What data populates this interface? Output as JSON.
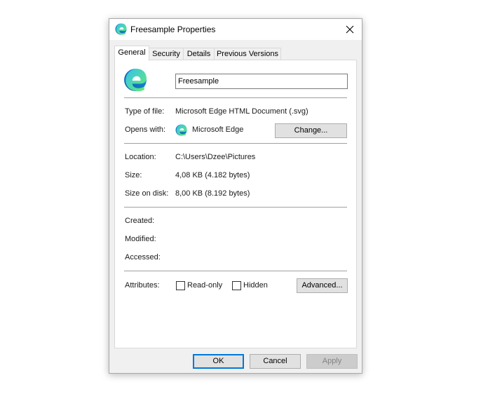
{
  "window": {
    "title": "Freesample Properties",
    "close_icon": "close-icon",
    "app_icon": "microsoft-edge-icon"
  },
  "tabs": [
    {
      "label": "General",
      "active": true
    },
    {
      "label": "Security",
      "active": false
    },
    {
      "label": "Details",
      "active": false
    },
    {
      "label": "Previous Versions",
      "active": false
    }
  ],
  "general": {
    "file_name": "Freesample",
    "type_of_file_label": "Type of file:",
    "type_of_file_value": "Microsoft Edge HTML Document (.svg)",
    "opens_with_label": "Opens with:",
    "opens_with_value": "Microsoft Edge",
    "change_button": "Change...",
    "location_label": "Location:",
    "location_value": "C:\\Users\\Dzee\\Pictures",
    "size_label": "Size:",
    "size_value": "4,08 KB (4.182 bytes)",
    "size_on_disk_label": "Size on disk:",
    "size_on_disk_value": "8,00 KB (8.192 bytes)",
    "created_label": "Created:",
    "modified_label": "Modified:",
    "accessed_label": "Accessed:",
    "attributes_label": "Attributes:",
    "readonly_label": "Read-only",
    "readonly_checked": false,
    "hidden_label": "Hidden",
    "hidden_checked": false,
    "advanced_button": "Advanced..."
  },
  "footer": {
    "ok": "OK",
    "cancel": "Cancel",
    "apply": "Apply"
  },
  "colors": {
    "dialog_bg": "#f0f0f0",
    "panel_bg": "#ffffff",
    "button_bg": "#e1e1e1",
    "focus_border": "#0078d7",
    "disabled_text": "#838383"
  }
}
